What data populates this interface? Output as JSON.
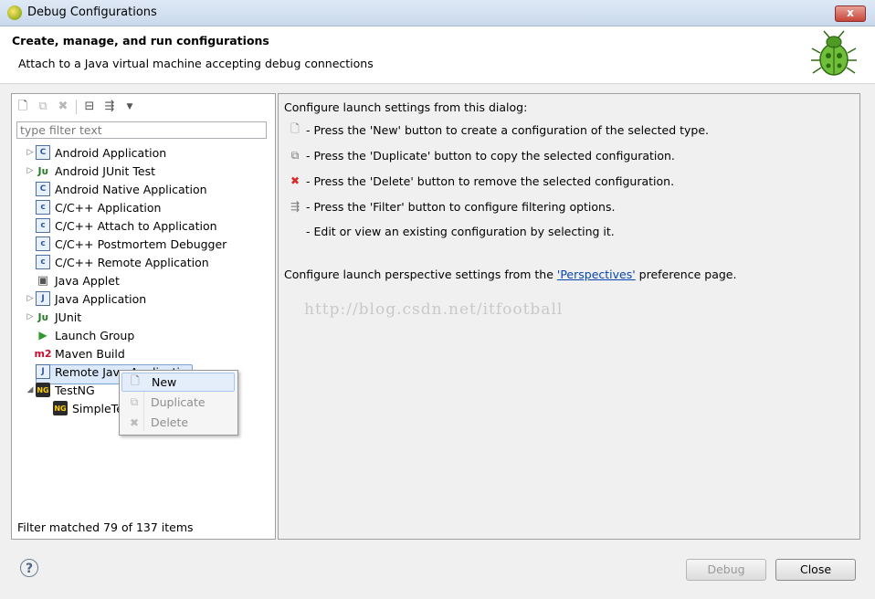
{
  "window": {
    "title": "Debug Configurations",
    "close_glyph": "x"
  },
  "header": {
    "title": "Create, manage, and run configurations",
    "subtitle": "Attach to a Java virtual machine accepting debug connections"
  },
  "left": {
    "filter_placeholder": "type filter text",
    "status": "Filter matched 79 of 137 items",
    "items": [
      {
        "label": "Android Application",
        "icon": "C",
        "arrow": "▷"
      },
      {
        "label": "Android JUnit Test",
        "icon": "Jᴜ",
        "arrow": "▷"
      },
      {
        "label": "Android Native Application",
        "icon": "C",
        "arrow": ""
      },
      {
        "label": "C/C++ Application",
        "icon": "c",
        "arrow": ""
      },
      {
        "label": "C/C++ Attach to Application",
        "icon": "c",
        "arrow": ""
      },
      {
        "label": "C/C++ Postmortem Debugger",
        "icon": "c",
        "arrow": ""
      },
      {
        "label": "C/C++ Remote Application",
        "icon": "c",
        "arrow": ""
      },
      {
        "label": "Java Applet",
        "icon": "▣",
        "arrow": ""
      },
      {
        "label": "Java Application",
        "icon": "J",
        "arrow": "▷"
      },
      {
        "label": "JUnit",
        "icon": "Jᴜ",
        "arrow": "▷"
      },
      {
        "label": "Launch Group",
        "icon": "▶",
        "arrow": ""
      },
      {
        "label": "Maven Build",
        "icon": "m2",
        "arrow": ""
      },
      {
        "label": "Remote Java Application",
        "icon": "J",
        "arrow": ""
      },
      {
        "label": "TestNG",
        "icon": "NG",
        "arrow": "◢"
      },
      {
        "label": "SimpleTest",
        "icon": "NG",
        "arrow": ""
      }
    ]
  },
  "right": {
    "intro": "Configure launch settings from this dialog:",
    "lines": [
      "- Press the 'New' button to create a configuration of the selected type.",
      "- Press the 'Duplicate' button to copy the selected configuration.",
      "- Press the 'Delete' button to remove the selected configuration.",
      "- Press the 'Filter' button to configure filtering options.",
      "- Edit or view an existing configuration by selecting it."
    ],
    "perspective_prefix": "Configure launch perspective settings from the",
    "perspective_link": "'Perspectives'",
    "perspective_suffix": "preference page.",
    "watermark": "http://blog.csdn.net/itfootball"
  },
  "context_menu": {
    "new": "New",
    "duplicate": "Duplicate",
    "delete": "Delete"
  },
  "buttons": {
    "help": "?",
    "debug": "Debug",
    "close": "Close"
  }
}
